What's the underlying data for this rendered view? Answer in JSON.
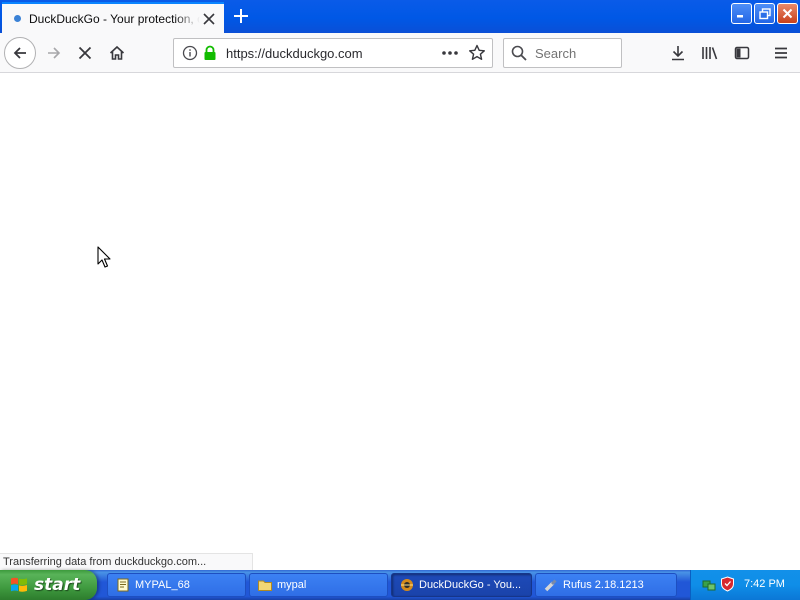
{
  "browser": {
    "tab": {
      "title": "DuckDuckGo - Your protection, our priority"
    },
    "url": "https://duckduckgo.com",
    "search_placeholder": "Search",
    "status_text": "Transferring data from duckduckgo.com..."
  },
  "taskbar": {
    "start_label": "start",
    "items": [
      {
        "label": "MYPAL_68",
        "icon": "text-file-icon",
        "active": false
      },
      {
        "label": "mypal",
        "icon": "folder-icon",
        "active": false
      },
      {
        "label": "DuckDuckGo - You...",
        "icon": "mypal-browser-icon",
        "active": true
      },
      {
        "label": "Rufus 2.18.1213",
        "icon": "usb-drive-icon",
        "active": false
      }
    ],
    "clock": "7:42 PM"
  },
  "colors": {
    "title_bar": "#0058e6",
    "taskbar": "#2157d7",
    "start_button": "#3f9a3f",
    "tray": "#0f8ee8",
    "lock_green": "#12bc00",
    "tab_accent": "#0a84ff"
  }
}
